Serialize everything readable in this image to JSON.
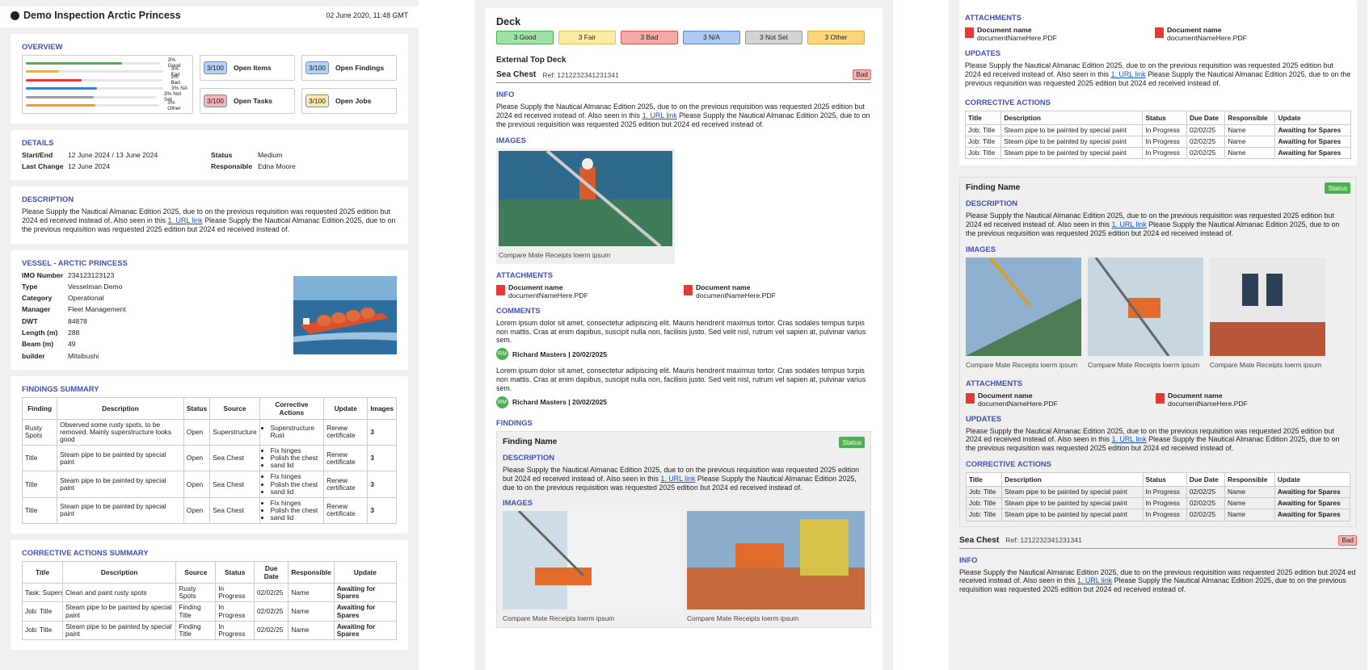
{
  "report": {
    "title": "Demo Inspection Arctic Princess",
    "date": "02 June 2020, 11:48 GMT"
  },
  "overview": {
    "heading": "OVERVIEW",
    "bars": [
      {
        "label": "3% Good",
        "fill": 0.72,
        "color": "#4caf50"
      },
      {
        "label": "3% Fair",
        "fill": 0.24,
        "color": "#ffb300"
      },
      {
        "label": "3% Bad",
        "fill": 0.41,
        "color": "#e53935"
      },
      {
        "label": "3% NA",
        "fill": 0.52,
        "color": "#3f7fd8"
      },
      {
        "label": "3% Not Set",
        "fill": 0.52,
        "color": "#9e9e9e"
      },
      {
        "label": "3% Other",
        "fill": 0.52,
        "color": "#ffa000"
      }
    ],
    "stats": [
      {
        "value": "3/100",
        "label": "Open Items",
        "color": "#b5cff5"
      },
      {
        "value": "3/100",
        "label": "Open Findings",
        "color": "#b5cff5"
      },
      {
        "value": "3/100",
        "label": "Open Tasks",
        "color": "#f4b4b0"
      },
      {
        "value": "3/100",
        "label": "Open Jobs",
        "color": "#fde9a8"
      }
    ]
  },
  "details": {
    "heading": "DETAILS",
    "startend_label": "Start/End",
    "startend": "12 June  2024 / 13 June  2024",
    "status_label": "Status",
    "status": "Medium",
    "lastchange_label": "Last Change",
    "lastchange": "12 June  2024",
    "responsible_label": "Responsible",
    "responsible": "Edna Moore"
  },
  "description": {
    "heading": "DESCRIPTION",
    "text_a": "Please Supply the Nautical Almanac Edition 2025, due to on the previous requisition was requested 2025 edition but 2024 ed received instead of. Also seen in this ",
    "link": "1. URL link",
    "text_b": " Please Supply the Nautical Almanac Edition 2025, due to on the previous requisition was requested 2025 edition but 2024 ed received instead of."
  },
  "vessel": {
    "heading": "VESSEL - ARCTIC PRINCESS",
    "rows": [
      [
        "IMO Number",
        "234123123123"
      ],
      [
        "Type",
        "Vesselman Demo"
      ],
      [
        "Category",
        "Operational"
      ],
      [
        "Manager",
        "Fleet Management"
      ],
      [
        "DWT",
        "84878"
      ],
      [
        "Length (m)",
        "288"
      ],
      [
        "Beam (m)",
        "49"
      ],
      [
        "builder",
        "Mitsibushi"
      ]
    ]
  },
  "findings_summary": {
    "heading": "FINDINGS SUMMARY",
    "headers": [
      "Finding",
      "Description",
      "Status",
      "Source",
      "Corrective Actions",
      "Update",
      "Images"
    ],
    "rows": [
      {
        "c": [
          "Rusty Spots",
          "Observed some rusty spots, to be removed. Mainly superstructure looks good",
          "Open",
          "Superstructure"
        ],
        "acts": [
          "Superstructure Rust"
        ],
        "u": "Renew certificate",
        "i": "3"
      },
      {
        "c": [
          "Title",
          "Steam pipe to be painted by special paint",
          "Open",
          "Sea Chest"
        ],
        "acts": [
          "Fix hinges",
          "Polish the chest",
          "sand lid"
        ],
        "u": "Renew certificate",
        "i": "3"
      },
      {
        "c": [
          "Title",
          "Steam pipe to be painted by special paint",
          "Open",
          "Sea Chest"
        ],
        "acts": [
          "Fix hinges",
          "Polish the chest",
          "sand lid"
        ],
        "u": "Renew certificate",
        "i": "3"
      },
      {
        "c": [
          "Title",
          "Steam pipe to be painted by special paint",
          "Open",
          "Sea Chest"
        ],
        "acts": [
          "Fix hinges",
          "Polish the chest",
          "sand lid"
        ],
        "u": "Renew certificate",
        "i": "3"
      }
    ]
  },
  "ca_summary": {
    "heading": "CORRECTIVE ACTIONS SUMMARY",
    "headers": [
      "Title",
      "Description",
      "Source",
      "Status",
      "Due Date",
      "Responsible",
      "Update"
    ],
    "rows": [
      [
        "Task: Supers",
        "Clean and paint rusty spots",
        "Rusty Spots",
        "In Progress",
        "02/02/25",
        "Name",
        "Awaiting for Spares"
      ],
      [
        "Job: Title",
        "Steam pipe to be painted by special paint",
        "Finding Title",
        "In Progress",
        "02/02/25",
        "Name",
        "Awaiting for Spares"
      ],
      [
        "Job: Title",
        "Steam pipe to be painted by special paint",
        "Finding Title",
        "In Progress",
        "02/02/25",
        "Name",
        "Awaiting for Spares"
      ]
    ]
  },
  "deck": {
    "title": "Deck",
    "tabs": [
      {
        "label": "3 Good",
        "bg": "#9fe0a6",
        "bd": "#4caf50"
      },
      {
        "label": "3 Fair",
        "bg": "#fdeaa6",
        "bd": "#e6c253"
      },
      {
        "label": "3 Bad",
        "bg": "#f3a9a5",
        "bd": "#d55"
      },
      {
        "label": "3 N/A",
        "bg": "#b0c9f3",
        "bd": "#5c85d6"
      },
      {
        "label": "3 Not Set",
        "bg": "#d3d3d3",
        "bd": "#999"
      },
      {
        "label": "3 Other",
        "bg": "#fcd67e",
        "bd": "#e0a828"
      }
    ],
    "sub": "External Top Deck",
    "sea": "Sea Chest",
    "ref": "Ref: 1212232341231341",
    "bad": "Bad",
    "info": "INFO",
    "images": "IMAGES",
    "caption": "Compare Mate Receipts loerm ipsum",
    "attachments": "ATTACHMENTS",
    "doc_name": "Document name",
    "doc_file": "documentNameHere.PDF",
    "comments": "COMMENTS",
    "comment": "Lorem ipsum dolor sit amet, consectetur adipiscing elit. Mauris hendrerit maximus tortor. Cras sodales tempus turpis non mattis. Cras at enim dapibus, suscipit nulla non, facilisis justo. Sed velit nisl, rutrum vel sapien at, pulvinar varius sem.",
    "author": "Richard Masters | 20/02/2025",
    "initials": "RM",
    "findings": "FINDINGS",
    "finding_name": "Finding Name",
    "status": "Status",
    "desc_h": "DESCRIPTION",
    "updates": "UPDATES",
    "ca_h": "CORRECTIVE ACTIONS"
  },
  "ca_table": {
    "headers": [
      "Title",
      "Description",
      "Status",
      "Due Date",
      "Responsible",
      "Update"
    ],
    "rows": [
      [
        "Job: Title",
        "Steam pipe to be painted by special paint",
        "In Progress",
        "02/02/25",
        "Name",
        "Awaiting for Spares"
      ],
      [
        "Job: Title",
        "Steam pipe to be painted by special paint",
        "In Progress",
        "02/02/25",
        "Name",
        "Awaiting for Spares"
      ],
      [
        "Job: Title",
        "Steam pipe to be painted by special paint",
        "In Progress",
        "02/02/25",
        "Name",
        "Awaiting for Spares"
      ]
    ]
  }
}
